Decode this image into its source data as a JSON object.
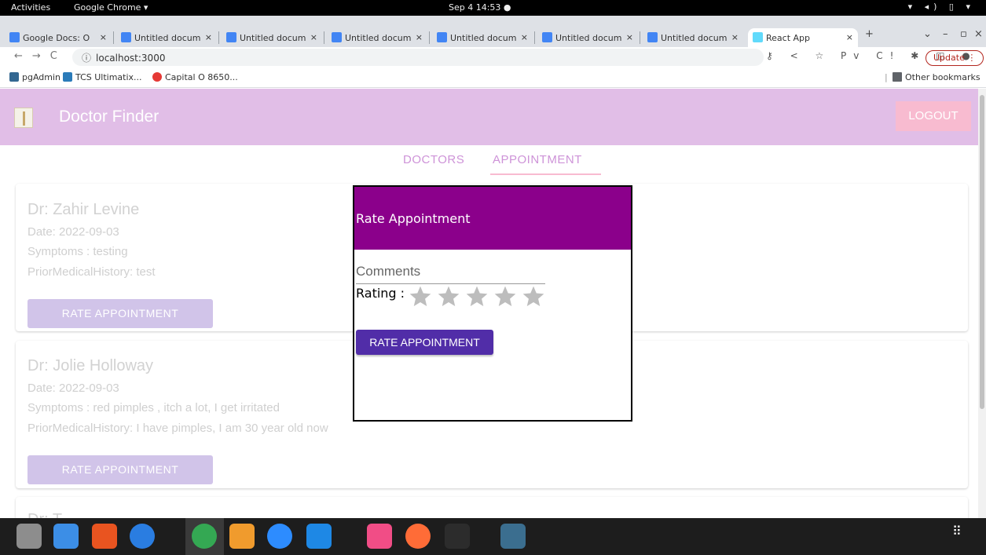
{
  "system_bar": {
    "activities": "Activities",
    "app_name": "Google Chrome ▾",
    "clock": "Sep 4  14:53  ●"
  },
  "browser": {
    "tabs": [
      {
        "label": "Google Docs: O",
        "favicon": "google-icon",
        "color": "#4285f4"
      },
      {
        "label": "Untitled docum",
        "favicon": "docs-icon",
        "color": "#4285f4"
      },
      {
        "label": "Untitled docum",
        "favicon": "docs-icon",
        "color": "#4285f4"
      },
      {
        "label": "Untitled docum",
        "favicon": "docs-icon",
        "color": "#4285f4"
      },
      {
        "label": "Untitled docum",
        "favicon": "docs-icon",
        "color": "#4285f4"
      },
      {
        "label": "Untitled docum",
        "favicon": "docs-icon",
        "color": "#4285f4"
      },
      {
        "label": "Untitled docum",
        "favicon": "docs-icon",
        "color": "#4285f4"
      },
      {
        "label": "React App",
        "favicon": "react-icon",
        "color": "#61dafb",
        "active": true
      }
    ],
    "url": "localhost:3000",
    "update_label": "Update",
    "bookmarks": [
      {
        "label": "pgAdmin 4",
        "color": "#336791"
      },
      {
        "label": "TCS Ultimatix...",
        "color": "#2b7bb9"
      },
      {
        "label": "Capital O 8650...",
        "color": "#e53935"
      }
    ],
    "other_bookmarks": "Other bookmarks"
  },
  "app": {
    "title": "Doctor Finder",
    "logout_label": "LOGOUT",
    "nav_tabs": [
      "DOCTORS",
      "APPOINTMENT"
    ],
    "appointments": [
      {
        "doctor": "Dr: Zahir Levine",
        "date": "Date: 2022-09-03",
        "symptoms": "Symptoms : testing",
        "history": "PriorMedicalHistory: test",
        "button": "RATE APPOINTMENT"
      },
      {
        "doctor": "Dr: Jolie Holloway",
        "date": "Date: 2022-09-03",
        "symptoms": "Symptoms : red pimples , itch a lot, I get irritated",
        "history": "PriorMedicalHistory: I have pimples, I am 30 year old now",
        "button": "RATE APPOINTMENT"
      },
      {
        "doctor": "Dr: T"
      }
    ],
    "modal": {
      "title": "Rate Appointment",
      "comments_placeholder": "Comments",
      "rating_label": "Rating :",
      "stars": 5,
      "selected_stars": 0,
      "submit_label": "RATE APPOINTMENT"
    }
  },
  "dock": {
    "apps": [
      {
        "name": "files-icon",
        "color": "#8d8d8d"
      },
      {
        "name": "text-editor-icon",
        "color": "#3c8ee6"
      },
      {
        "name": "software-store-icon",
        "color": "#e95420"
      },
      {
        "name": "help-icon",
        "color": "#2a7de1"
      },
      {
        "name": "chrome-icon",
        "color": "#34a853"
      },
      {
        "name": "sublime-text-icon",
        "color": "#f09b2d"
      },
      {
        "name": "zoom-icon",
        "color": "#2d8cff"
      },
      {
        "name": "vscode-icon",
        "color": "#1e88e5"
      },
      {
        "name": "intellij-icon",
        "color": "#f14d86"
      },
      {
        "name": "postman-icon",
        "color": "#ff6c37"
      },
      {
        "name": "terminal-icon",
        "color": "#2c2c2c"
      },
      {
        "name": "mysql-workbench-icon",
        "color": "#3b6e8f"
      }
    ]
  }
}
